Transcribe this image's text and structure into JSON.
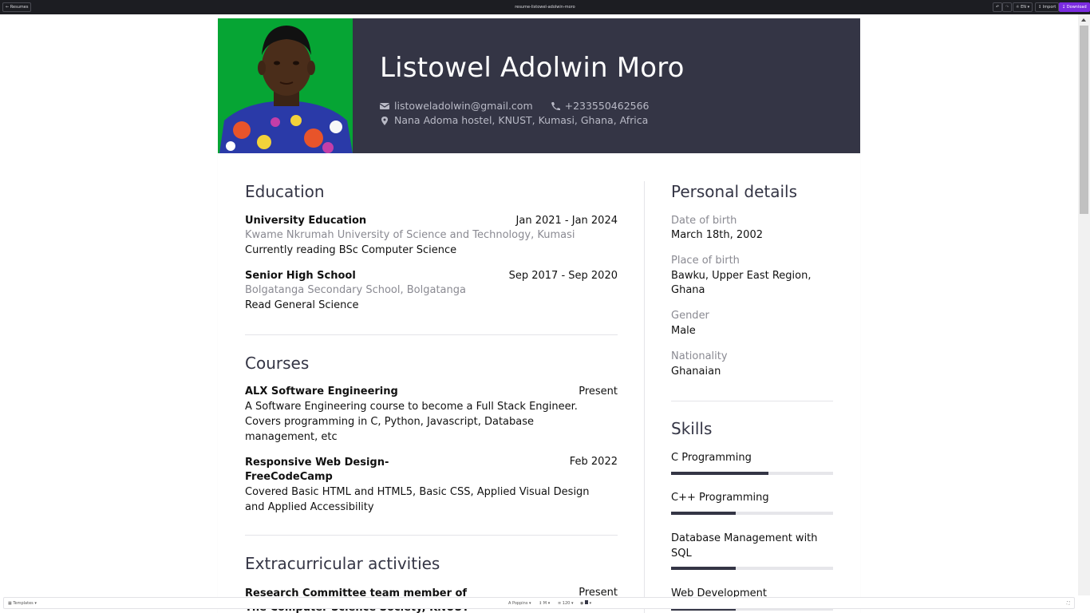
{
  "topbar": {
    "back_label": "Resumes",
    "doc_title": "resume-listowel-adolwin-moro",
    "lang_label": "EN",
    "import_label": "Import",
    "download_label": "Download"
  },
  "resume": {
    "name": "Listowel Adolwin Moro",
    "email": "listoweladolwin@gmail.com",
    "phone": "+233550462566",
    "location": "Nana Adoma hostel, KNUST, Kumasi, Ghana, Africa"
  },
  "education": {
    "heading": "Education",
    "entries": [
      {
        "title": "University Education",
        "date": "Jan 2021 - Jan 2024",
        "institution": "Kwame Nkrumah University of Science and Technology, Kumasi",
        "description": "Currently reading BSc Computer Science"
      },
      {
        "title": "Senior High School",
        "date": "Sep 2017 - Sep 2020",
        "institution": "Bolgatanga Secondary School, Bolgatanga",
        "description": "Read General Science"
      }
    ]
  },
  "courses": {
    "heading": "Courses",
    "entries": [
      {
        "title": "ALX Software Engineering",
        "date": "Present",
        "description": "A Software Engineering course to become a Full Stack Engineer. Covers programming in C, Python, Javascript, Database management, etc"
      },
      {
        "title": "Responsive Web Design- FreeCodeCamp",
        "date": "Feb 2022",
        "description": "Covered Basic HTML and HTML5,  Basic CSS, Applied Visual Design and Applied Accessibility"
      }
    ]
  },
  "extracurricular": {
    "heading": "Extracurricular activities",
    "entries": [
      {
        "title": "Research Committee team member of The Computer Science Society, KNUST",
        "date": "Present"
      }
    ]
  },
  "personal": {
    "heading": "Personal details",
    "items": [
      {
        "label": "Date of birth",
        "value": "March 18th, 2002"
      },
      {
        "label": "Place of birth",
        "value": "Bawku, Upper East Region, Ghana"
      },
      {
        "label": "Gender",
        "value": "Male"
      },
      {
        "label": "Nationality",
        "value": "Ghanaian"
      }
    ]
  },
  "skills": {
    "heading": "Skills",
    "items": [
      {
        "name": "C Programming",
        "level": 0.6
      },
      {
        "name": "C++ Programming",
        "level": 0.4
      },
      {
        "name": "Database Management with SQL",
        "level": 0.4
      },
      {
        "name": "Web Development",
        "level": 0.4
      }
    ]
  },
  "bottombar": {
    "templates_label": "Templates",
    "font_label": "Poppins",
    "size_label": "M",
    "spacing_label": "120",
    "colors": {
      "page_header": "#343545",
      "photo_background": "#06a534",
      "accent": "#7a2be0"
    }
  }
}
